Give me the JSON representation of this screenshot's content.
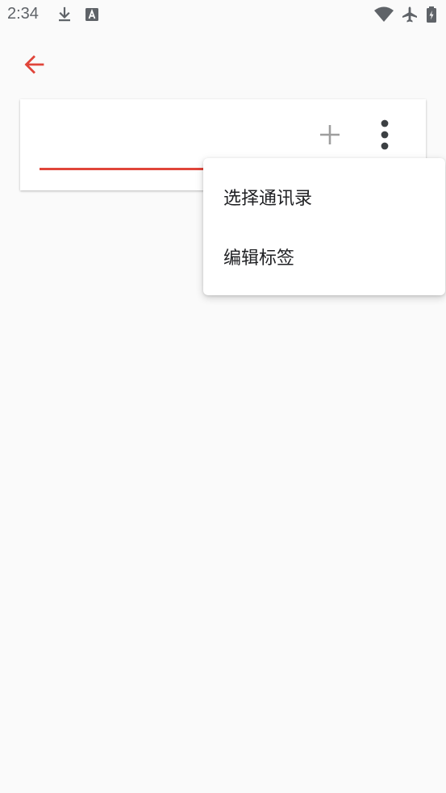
{
  "status_bar": {
    "time": "2:34",
    "icons": [
      "download-icon",
      "text-a-icon",
      "wifi-icon",
      "airplane-icon",
      "battery-charging-icon"
    ]
  },
  "toolbar": {
    "back_icon": "arrow-left-icon"
  },
  "card": {
    "add_icon": "plus-icon",
    "more_icon": "more-vertical-icon"
  },
  "menu": {
    "items": [
      {
        "label": "选择通讯录"
      },
      {
        "label": "编辑标签"
      }
    ]
  },
  "colors": {
    "accent": "#e0453a",
    "background": "#fafafa",
    "card": "#ffffff",
    "icon_gray": "#9e9e9e",
    "icon_dark": "#3c4043"
  }
}
